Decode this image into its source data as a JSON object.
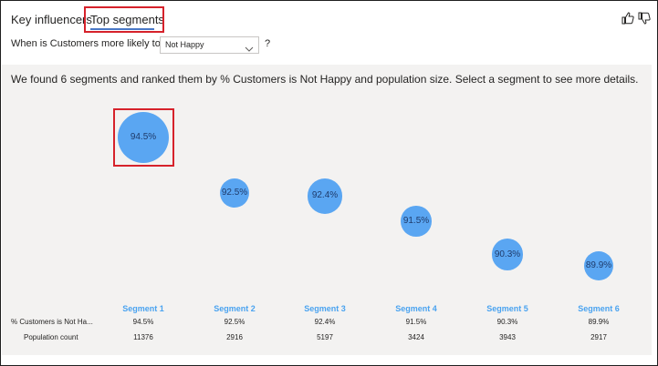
{
  "tabs": [
    {
      "label": "Key influencers",
      "selected": false
    },
    {
      "label": "Top segments",
      "selected": true
    }
  ],
  "question": {
    "label": "When is Customers more likely to be",
    "dropdown_value": "Not Happy",
    "help": "?"
  },
  "feedback": {
    "thumbs_up_icon": "thumbs-up-icon",
    "thumbs_down_icon": "thumbs-down-icon"
  },
  "summary": "We found 6 segments and ranked them by % Customers is Not Happy and population size. Select a segment to see more details.",
  "segments": [
    {
      "name": "Segment 1",
      "bubble_label": "94.5%",
      "percent_not_happy": "94.5%",
      "population_count": "11376",
      "percent_value": 94.5,
      "population_value": 11376,
      "highlighted": true
    },
    {
      "name": "Segment 2",
      "bubble_label": "92.5%",
      "percent_not_happy": "92.5%",
      "population_count": "2916",
      "percent_value": 92.5,
      "population_value": 2916,
      "highlighted": false
    },
    {
      "name": "Segment 3",
      "bubble_label": "92.4%",
      "percent_not_happy": "92.4%",
      "population_count": "5197",
      "percent_value": 92.4,
      "population_value": 5197,
      "highlighted": false
    },
    {
      "name": "Segment 4",
      "bubble_label": "91.5%",
      "percent_not_happy": "91.5%",
      "population_count": "3424",
      "percent_value": 91.5,
      "population_value": 3424,
      "highlighted": false
    },
    {
      "name": "Segment 5",
      "bubble_label": "90.3%",
      "percent_not_happy": "90.3%",
      "population_count": "3943",
      "percent_value": 90.3,
      "population_value": 3943,
      "highlighted": false
    },
    {
      "name": "Segment 6",
      "bubble_label": "89.9%",
      "percent_not_happy": "89.9%",
      "population_count": "2917",
      "percent_value": 89.9,
      "population_value": 2917,
      "highlighted": false
    }
  ],
  "rows": {
    "percent_label": "% Customers is Not Ha...",
    "population_label": "Population count"
  },
  "colors": {
    "bubble": "#5aa6f2",
    "segment_header": "#4aa3f0",
    "highlight": "#d6222b",
    "tab_underline": "#4a78c6",
    "panel_bg": "#f3f2f1"
  }
}
